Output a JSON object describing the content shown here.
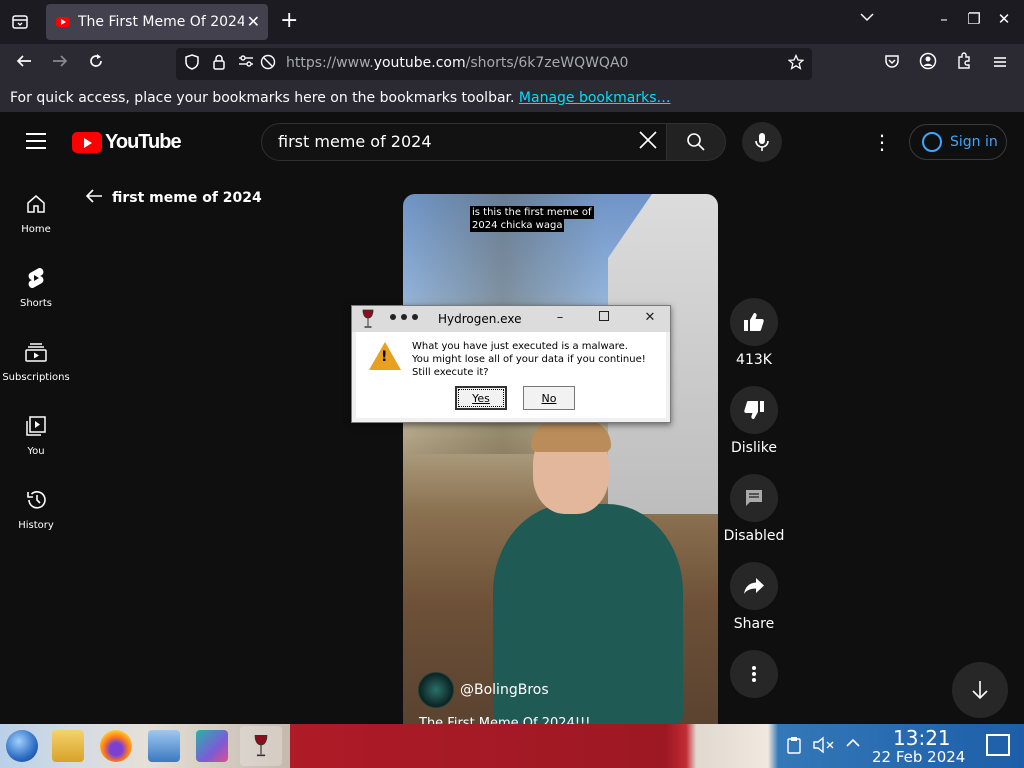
{
  "browser": {
    "tab_title": "The First Meme Of 2024!",
    "url_prefix": "https://www.",
    "url_host": "youtube.com",
    "url_path": "/shorts/6k7zeWQWQA0",
    "bookmarks_hint": "For quick access, place your bookmarks here on the bookmarks toolbar.",
    "bookmarks_link": "Manage bookmarks…"
  },
  "youtube": {
    "logo_text": "YouTube",
    "search_value": "first meme of 2024",
    "signin_label": "Sign in",
    "back_query": "first meme of 2024",
    "guide": [
      {
        "label": "Home",
        "icon": "home-icon"
      },
      {
        "label": "Shorts",
        "icon": "shorts-icon"
      },
      {
        "label": "Subscriptions",
        "icon": "subscriptions-icon"
      },
      {
        "label": "You",
        "icon": "you-icon"
      },
      {
        "label": "History",
        "icon": "history-icon"
      }
    ],
    "video": {
      "caption_line1": "is this the first meme of",
      "caption_line2": "2024 chicka waga",
      "channel": "@BolingBros",
      "title": "The First Meme Of 2024!!!"
    },
    "actions": {
      "likes": "413K",
      "dislike": "Dislike",
      "comments": "Disabled",
      "share": "Share"
    }
  },
  "dialog": {
    "title": "Hydrogen.exe",
    "line1": "What you have just executed is a malware.",
    "line2": "You might lose all of your data if you continue!",
    "line3": "Still execute it?",
    "yes": "Yes",
    "no": "No"
  },
  "taskbar": {
    "time": "13:21",
    "date": "22 Feb 2024"
  },
  "colors": {
    "yt_red": "#ff0000",
    "link_blue": "#3ea6ff",
    "firefox_link": "#00ddff",
    "warn_orange": "#e8a020"
  }
}
